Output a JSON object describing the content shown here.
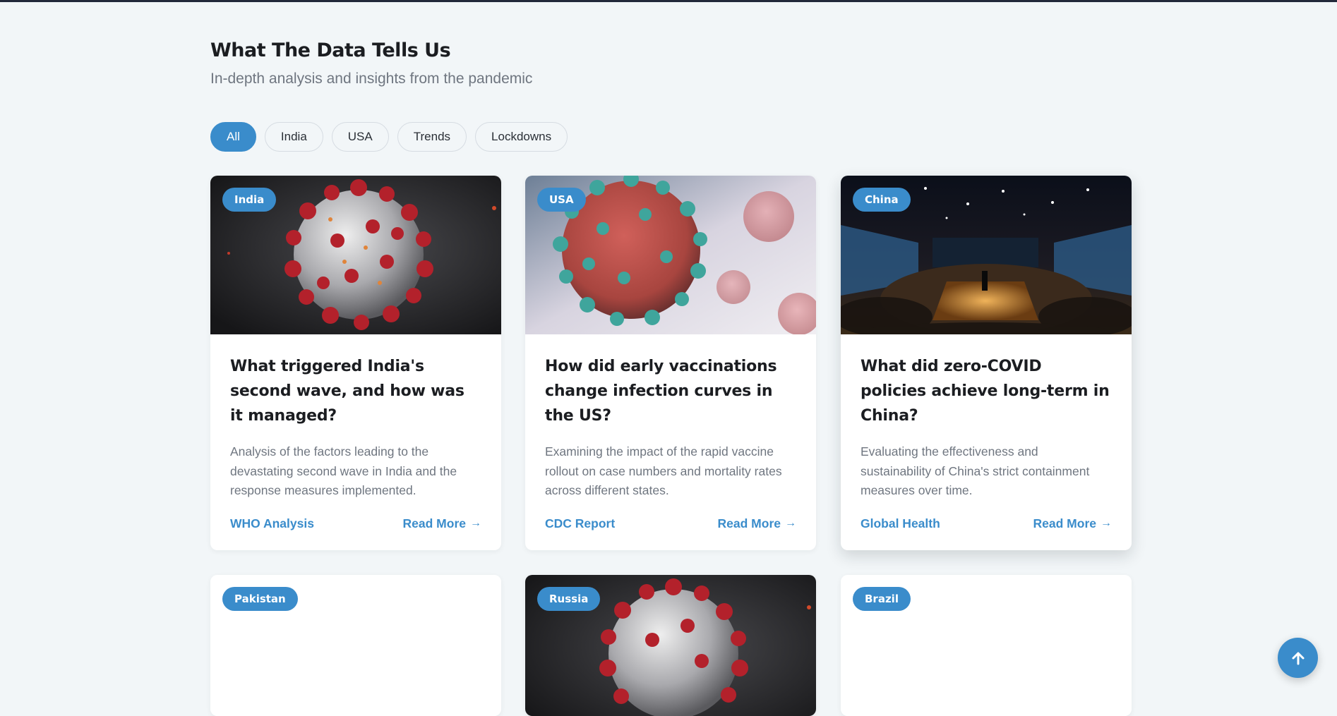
{
  "section": {
    "title": "What The Data Tells Us",
    "subtitle": "In-depth analysis and insights from the pandemic"
  },
  "filters": [
    {
      "label": "All",
      "active": true
    },
    {
      "label": "India",
      "active": false
    },
    {
      "label": "USA",
      "active": false
    },
    {
      "label": "Trends",
      "active": false
    },
    {
      "label": "Lockdowns",
      "active": false
    }
  ],
  "cards": [
    {
      "badge": "India",
      "image": "virus-illustration-dark",
      "title": "What triggered India's second wave, and how was it managed?",
      "description": "Analysis of the factors leading to the devastating second wave in India and the response measures implemented.",
      "source": "WHO Analysis",
      "read_more": "Read More"
    },
    {
      "badge": "USA",
      "image": "virus-particles-light",
      "title": "How did early vaccinations change infection curves in the US?",
      "description": "Examining the impact of the rapid vaccine rollout on case numbers and mortality rates across different states.",
      "source": "CDC Report",
      "read_more": "Read More"
    },
    {
      "badge": "China",
      "image": "conference-audience",
      "title": "What did zero-COVID policies achieve long-term in China?",
      "description": "Evaluating the effectiveness and sustainability of China's strict containment measures over time.",
      "source": "Global Health",
      "read_more": "Read More"
    },
    {
      "badge": "Pakistan",
      "image": "blank"
    },
    {
      "badge": "Russia",
      "image": "virus-illustration-dark"
    },
    {
      "badge": "Brazil",
      "image": "blank"
    }
  ],
  "colors": {
    "accent": "#3a8ccb",
    "background": "#f2f6f8",
    "muted_text": "#6f7680"
  },
  "icons": {
    "read_more": "arrow-right-icon",
    "scroll_top": "arrow-up-icon"
  }
}
